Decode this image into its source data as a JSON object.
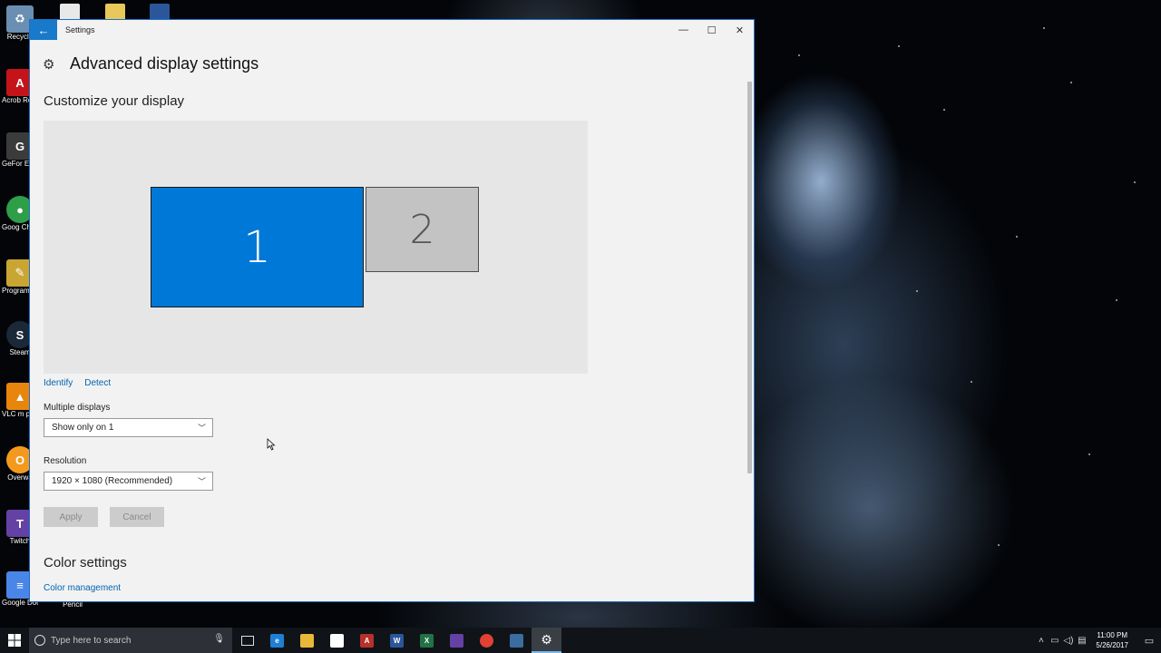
{
  "desktop": {
    "icons": [
      {
        "label": "Recycle",
        "icon": "recycle-bin-icon",
        "color": "#6a8fb3"
      },
      {
        "label": "Acrob Reader",
        "icon": "acrobat-reader-icon",
        "color": "#c4141a"
      },
      {
        "label": "GeFor Experie",
        "icon": "geforce-experience-icon",
        "color": "#3b3b3b"
      },
      {
        "label": "Goog Chrom",
        "icon": "google-chrome-icon",
        "color": "#2e9e49"
      },
      {
        "label": "Program Notep",
        "icon": "programmers-notepad-icon",
        "color": "#c9a632"
      },
      {
        "label": "Steam",
        "icon": "steam-icon",
        "color": "#1b2838"
      },
      {
        "label": "VLC m playe",
        "icon": "vlc-icon",
        "color": "#e8850c"
      },
      {
        "label": "Overwa",
        "icon": "overwatch-icon",
        "color": "#f39a1e"
      },
      {
        "label": "Twitch",
        "icon": "twitch-icon",
        "color": "#6441a4"
      },
      {
        "label": "Google Docs",
        "icon": "google-docs-icon",
        "color": "#4a86e8"
      },
      {
        "label": "Pencil",
        "icon": "pencil-icon",
        "color": "#6ec35a"
      }
    ]
  },
  "window": {
    "title": "Settings",
    "back_icon": "back-arrow-icon",
    "minimize": "—",
    "maximize": "☐",
    "close": "✕"
  },
  "page": {
    "title": "Advanced display settings",
    "customize_title": "Customize your display",
    "monitors": [
      "1",
      "2"
    ],
    "identify_link": "Identify",
    "detect_link": "Detect",
    "multiple_displays_label": "Multiple displays",
    "multiple_displays_value": "Show only on 1",
    "resolution_label": "Resolution",
    "resolution_value": "1920 × 1080 (Recommended)",
    "apply_label": "Apply",
    "cancel_label": "Cancel",
    "color_settings_title": "Color settings",
    "color_management_link": "Color management"
  },
  "taskbar": {
    "search_placeholder": "Type here to search",
    "apps": [
      {
        "name": "task-view",
        "label": "",
        "color": "#101418"
      },
      {
        "name": "edge",
        "label": "e",
        "color": "#1e7fd6"
      },
      {
        "name": "file-explorer",
        "label": "",
        "color": "#e8b938"
      },
      {
        "name": "store",
        "label": "",
        "color": "#ffffff"
      },
      {
        "name": "access",
        "label": "A",
        "color": "#b7312c"
      },
      {
        "name": "word",
        "label": "W",
        "color": "#2b579a"
      },
      {
        "name": "excel",
        "label": "X",
        "color": "#217346"
      },
      {
        "name": "twitch",
        "label": "",
        "color": "#6441a4"
      },
      {
        "name": "chrome",
        "label": "",
        "color": "#e34133"
      },
      {
        "name": "photos",
        "label": "",
        "color": "#3a6da0"
      },
      {
        "name": "settings",
        "label": "⚙",
        "color": "#3a3f46"
      }
    ],
    "time": "11:00 PM",
    "date": "5/26/2017"
  },
  "colors": {
    "accent": "#0078d7",
    "link": "#0063b1"
  }
}
